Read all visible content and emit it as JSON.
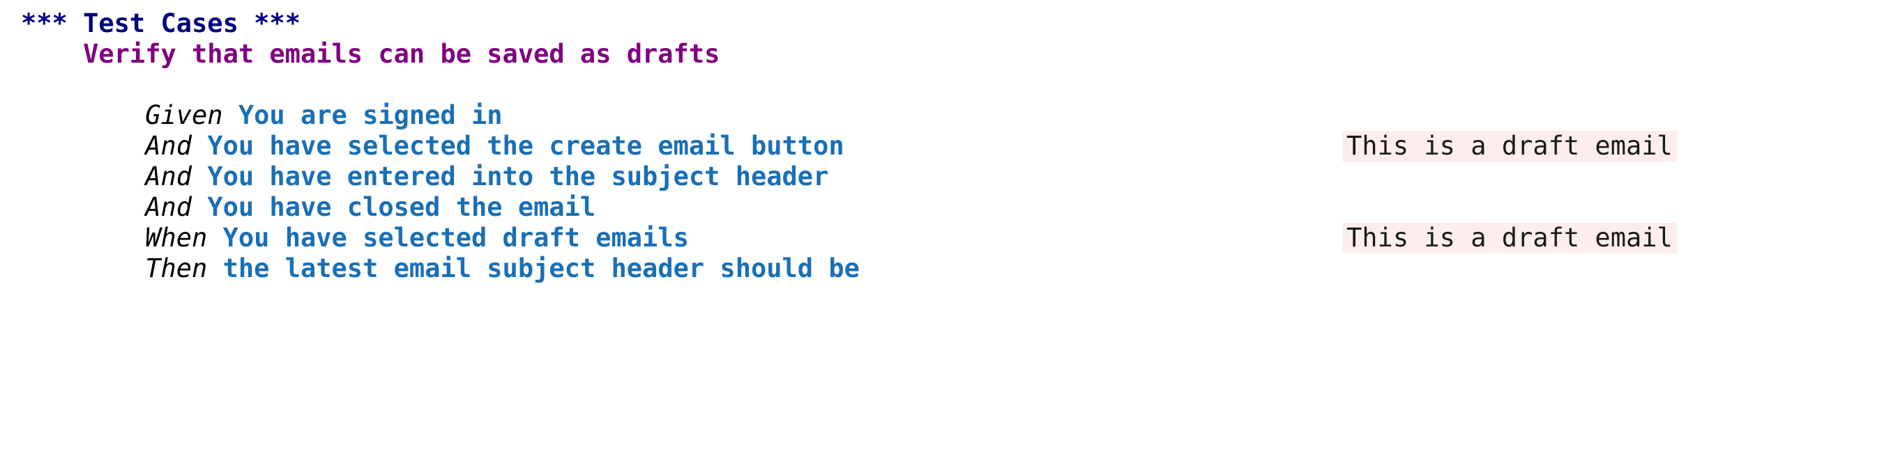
{
  "document": {
    "type": "robot-framework-test-suite",
    "section_header": "*** Test Cases ***",
    "colors": {
      "section_header": "#00007F",
      "test_case_name": "#800080",
      "keyword": "#000000",
      "argument": "#1A6FB5",
      "value_highlight_background": "#FDEDED",
      "value_text": "#1A1A1A",
      "page_background": "#FFFFFF"
    }
  },
  "test_case": {
    "name": "Verify that emails can be saved as drafts",
    "steps": [
      {
        "keyword": "Given",
        "argument": "You are signed in",
        "value": ""
      },
      {
        "keyword": "And",
        "argument": "You have selected the create email button",
        "value": ""
      },
      {
        "keyword": "And",
        "argument": "You have entered into the subject header",
        "value": "This is a draft email"
      },
      {
        "keyword": "And",
        "argument": "You have closed the email",
        "value": ""
      },
      {
        "keyword": "When",
        "argument": "You have selected draft emails",
        "value": ""
      },
      {
        "keyword": "Then",
        "argument": "the latest email subject header should be",
        "value": "This is a draft email"
      }
    ]
  }
}
